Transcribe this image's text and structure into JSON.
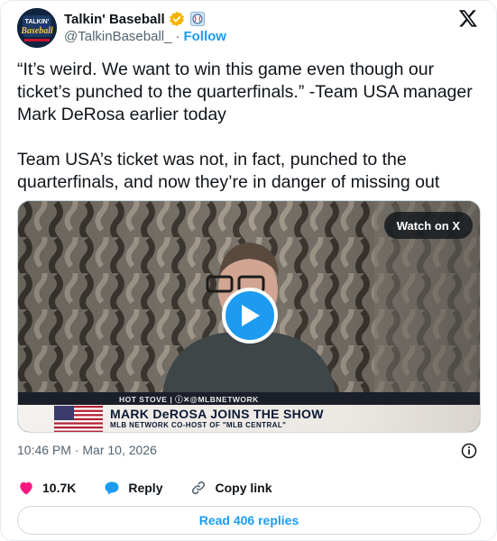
{
  "account": {
    "display_name": "Talkin' Baseball",
    "handle": "@TalkinBaseball_",
    "separator": "·",
    "follow_label": "Follow",
    "avatar_text_top": "TALKIN'",
    "avatar_text_main": "Baseball",
    "verified_color": "#F4B400",
    "affiliate_badge": "baseball-badge-icon"
  },
  "tweet": {
    "text": "“It’s weird. We want to win this game even though our ticket’s punched to the quarterfinals.” -Team USA manager Mark DeRosa earlier today\n\nTeam USA’s ticket was not, in fact, punched to the quarterfinals, and now they’re in danger of missing out"
  },
  "media": {
    "watch_label": "Watch on X",
    "lower_third_strip": "HOT STOVE  |  ⓘ✕@MLBNETWORK",
    "lower_third_title": "MARK DeROSA JOINS THE SHOW",
    "lower_third_subtitle": "MLB NETWORK CO-HOST OF \"MLB CENTRAL\""
  },
  "meta": {
    "timestamp": "10:46 PM · Mar 10, 2026"
  },
  "actions": {
    "like_count": "10.7K",
    "reply_label": "Reply",
    "copy_label": "Copy link"
  },
  "footer": {
    "read_replies": "Read 406 replies"
  },
  "colors": {
    "accent": "#1d9bf0",
    "like": "#f91880",
    "text": "#0f1419",
    "muted": "#536471"
  }
}
